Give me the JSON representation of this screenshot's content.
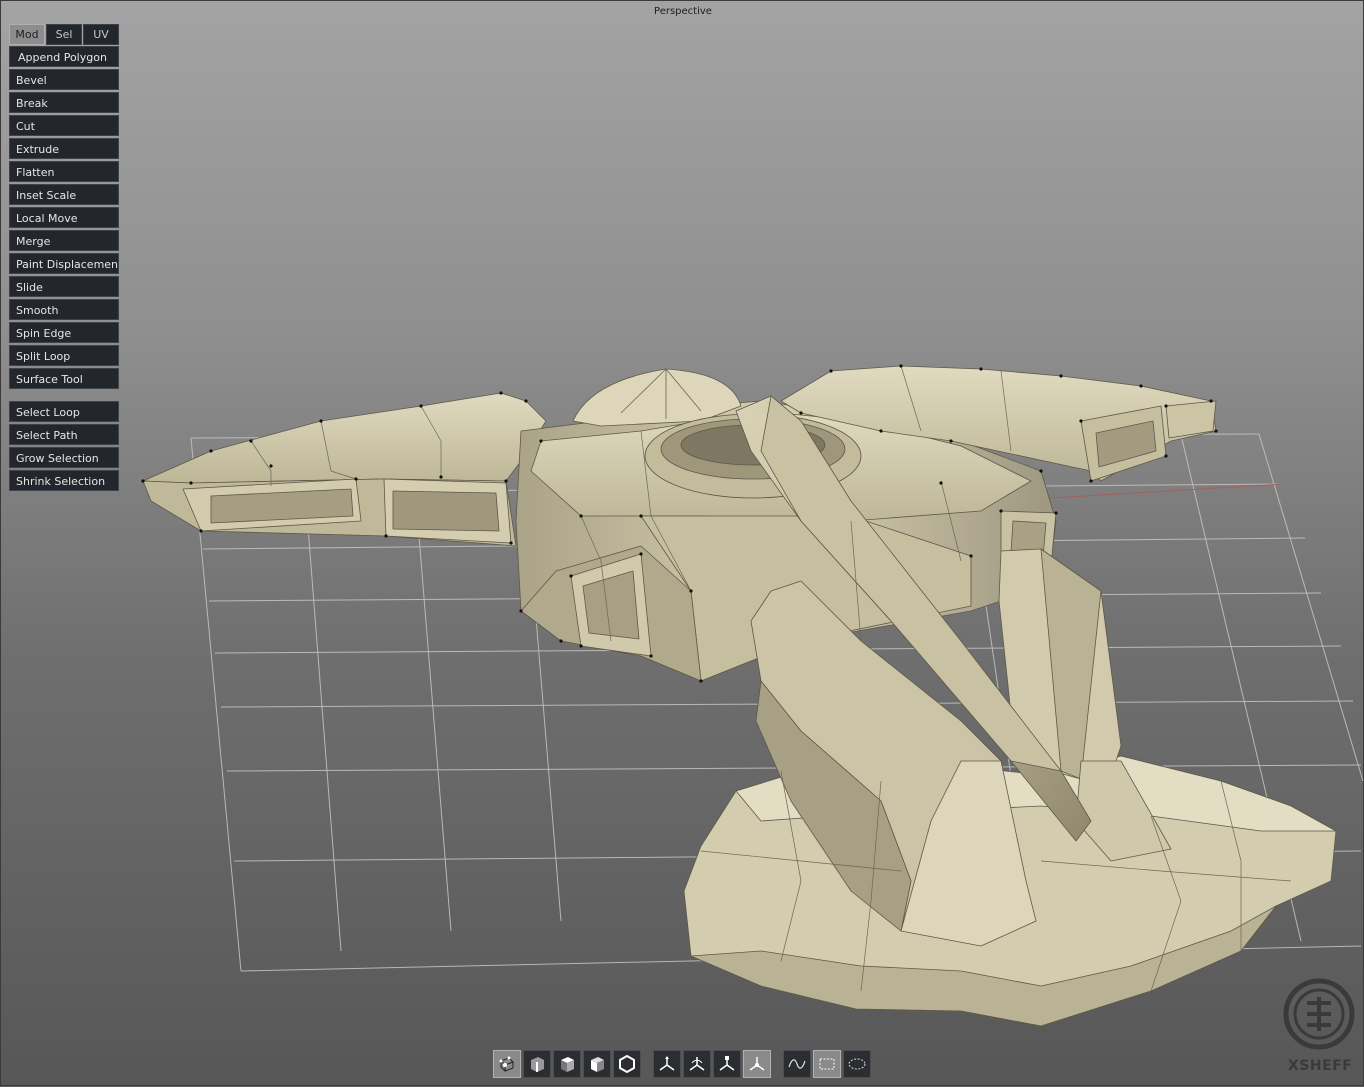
{
  "viewport": {
    "title": "Perspective"
  },
  "tool_panel": {
    "tabs": [
      {
        "label": "Mod",
        "active": true
      },
      {
        "label": "Sel",
        "active": false
      },
      {
        "label": "UV",
        "active": false
      }
    ],
    "tools": [
      "Append Polygon",
      "Bevel",
      "Break",
      "Cut",
      "Extrude",
      "Flatten",
      "Inset Scale",
      "Local Move",
      "Merge",
      "Paint Displacement",
      "Slide",
      "Smooth",
      "Spin Edge",
      "Split Loop",
      "Surface Tool"
    ],
    "selection_tools": [
      "Select Loop",
      "Select Path",
      "Grow Selection",
      "Shrink Selection"
    ]
  },
  "bottom_toolbar": {
    "buttons": [
      {
        "icon": "vertex-mode-icon",
        "active": true
      },
      {
        "icon": "edge-mode-icon",
        "active": false
      },
      {
        "icon": "face-mode-icon",
        "active": false
      },
      {
        "icon": "object-face-mode-icon",
        "active": false
      },
      {
        "icon": "object-mode-icon",
        "active": false
      },
      {
        "icon": "move-gizmo-icon",
        "active": false
      },
      {
        "icon": "rotate-gizmo-icon",
        "active": false
      },
      {
        "icon": "scale-gizmo-icon",
        "active": false
      },
      {
        "icon": "universal-gizmo-icon",
        "active": true
      },
      {
        "icon": "lasso-select-icon",
        "active": false
      },
      {
        "icon": "rect-select-icon",
        "active": true
      },
      {
        "icon": "paint-select-icon",
        "active": false
      }
    ]
  },
  "watermark": {
    "text": "XSHEFF"
  },
  "colors": {
    "mesh": "#cfc7a8",
    "mesh_dark": "#8c856c",
    "grid": "#c8c8c8",
    "panel_button": "#23272d",
    "active_tab": "#8d8d8d"
  }
}
